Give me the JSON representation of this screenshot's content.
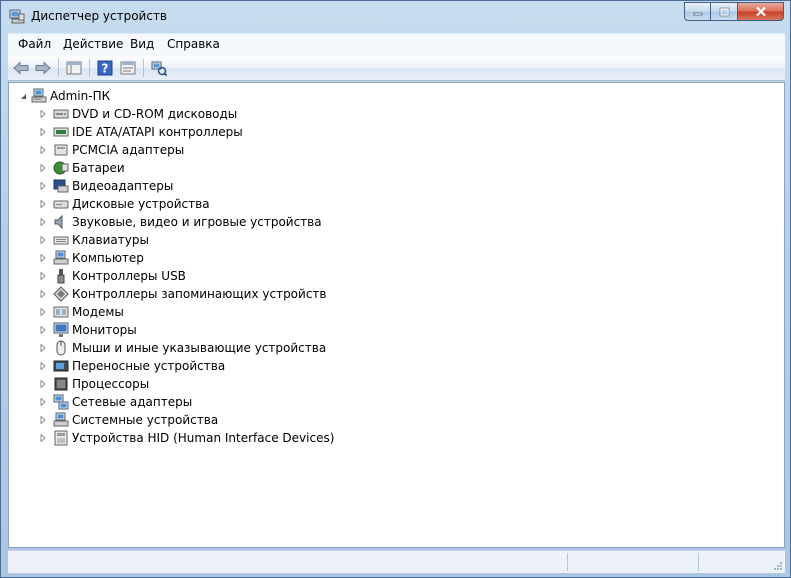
{
  "window": {
    "title": "Диспетчер устройств",
    "icon": "device-manager-icon"
  },
  "caption_buttons": {
    "minimize": "minimize-icon",
    "maximize": "maximize-icon",
    "close": "close-icon"
  },
  "menu": [
    {
      "label": "Файл",
      "name": "menu-file"
    },
    {
      "label": "Действие",
      "name": "menu-action"
    },
    {
      "label": "Вид",
      "name": "menu-view"
    },
    {
      "label": "Справка",
      "name": "menu-help"
    }
  ],
  "toolbar": [
    {
      "name": "back-button",
      "icon": "arrow-left-icon"
    },
    {
      "name": "forward-button",
      "icon": "arrow-right-icon"
    },
    {
      "name": "properties-pane-button",
      "icon": "console-tree-icon"
    },
    {
      "name": "help-button",
      "icon": "help-icon"
    },
    {
      "name": "properties-button",
      "icon": "properties-icon"
    },
    {
      "name": "scan-hardware-button",
      "icon": "scan-hardware-icon"
    }
  ],
  "tree": {
    "root": {
      "label": "Admin-ПК",
      "icon": "computer-icon",
      "expanded": true
    },
    "items": [
      {
        "label": "DVD и CD-ROM дисководы",
        "icon": "dvd-drive-icon"
      },
      {
        "label": "IDE ATA/ATAPI контроллеры",
        "icon": "ide-controller-icon"
      },
      {
        "label": "PCMCIA адаптеры",
        "icon": "pcmcia-icon"
      },
      {
        "label": "Батареи",
        "icon": "battery-icon"
      },
      {
        "label": "Видеоадаптеры",
        "icon": "display-adapter-icon"
      },
      {
        "label": "Дисковые устройства",
        "icon": "disk-drive-icon"
      },
      {
        "label": "Звуковые, видео и игровые устройства",
        "icon": "speaker-icon"
      },
      {
        "label": "Клавиатуры",
        "icon": "keyboard-icon"
      },
      {
        "label": "Компьютер",
        "icon": "computer-small-icon"
      },
      {
        "label": "Контроллеры USB",
        "icon": "usb-icon"
      },
      {
        "label": "Контроллеры запоминающих устройств",
        "icon": "storage-controller-icon"
      },
      {
        "label": "Модемы",
        "icon": "modem-icon"
      },
      {
        "label": "Мониторы",
        "icon": "monitor-icon"
      },
      {
        "label": "Мыши и иные указывающие устройства",
        "icon": "mouse-icon"
      },
      {
        "label": "Переносные устройства",
        "icon": "portable-device-icon"
      },
      {
        "label": "Процессоры",
        "icon": "processor-icon"
      },
      {
        "label": "Сетевые адаптеры",
        "icon": "network-adapter-icon"
      },
      {
        "label": "Системные устройства",
        "icon": "system-device-icon"
      },
      {
        "label": "Устройства HID (Human Interface Devices)",
        "icon": "hid-icon"
      }
    ]
  },
  "colors": {
    "title_bar": "#b9d1ea",
    "tree_background": "#ffffff",
    "close_button": "#c7442a"
  }
}
